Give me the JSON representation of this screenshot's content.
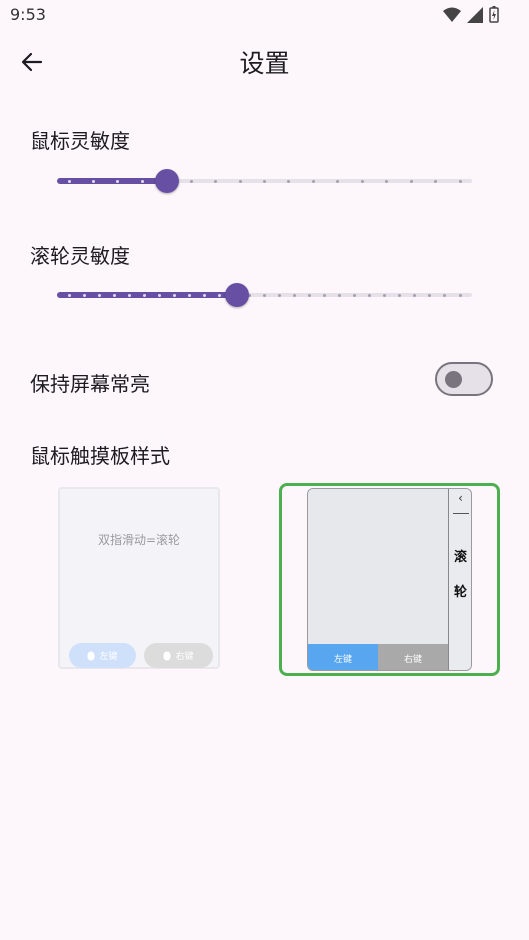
{
  "status_bar": {
    "time": "9:53",
    "icons": [
      "wifi-icon",
      "signal-icon",
      "battery-charging-icon"
    ]
  },
  "app_bar": {
    "title": "设置",
    "back_icon": "arrow-back-icon"
  },
  "mouse_sensitivity": {
    "label": "鼠标灵敏度",
    "value_fraction": 0.25,
    "steps": 16
  },
  "scroll_sensitivity": {
    "label": "滚轮灵敏度",
    "value_fraction": 0.43,
    "steps": 26
  },
  "keep_screen_on": {
    "label": "保持屏幕常亮",
    "enabled": false
  },
  "touchpad_style": {
    "label": "鼠标触摸板样式",
    "options": [
      {
        "hint": "双指滑动=滚轮",
        "left_button": "左键",
        "right_button": "右键",
        "selected": false
      },
      {
        "wheel_label_1": "滚",
        "wheel_label_2": "轮",
        "left_button": "左键",
        "right_button": "右键",
        "selected": true
      }
    ]
  },
  "colors": {
    "accent": "#6750a4",
    "selected_border": "#4caf50",
    "background": "#fdf7fc"
  }
}
